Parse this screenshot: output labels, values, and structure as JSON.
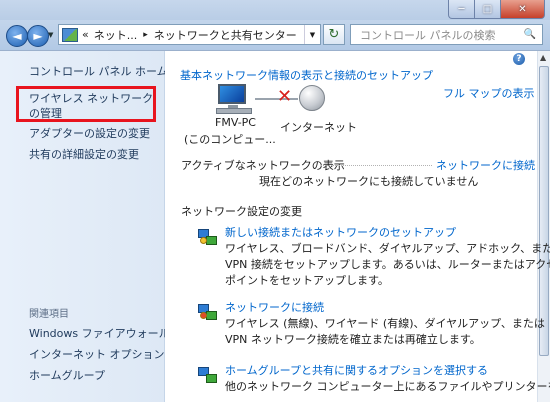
{
  "titlebar": {
    "minimize": "─",
    "maximize": "□",
    "close": "✕"
  },
  "toolbar": {
    "back": "◄",
    "forward": "►",
    "dropdown": "▼",
    "breadcrumb": {
      "overflow": "«",
      "item1": "ネット...",
      "separator": "▸",
      "item2": "ネットワークと共有センター"
    },
    "refresh": "↻",
    "search_placeholder": "コントロール パネルの検索",
    "search_icon": "🔍"
  },
  "sidebar": {
    "home": "コントロール パネル ホーム",
    "wireless": "ワイヤレス ネットワークの管理",
    "adapter": "アダプターの設定の変更",
    "sharing": "共有の詳細設定の変更",
    "related_heading": "関連項目",
    "firewall": "Windows ファイアウォール",
    "internet_options": "インターネット オプション",
    "homegroup": "ホームグループ"
  },
  "main": {
    "help": "?",
    "header_link": "基本ネットワーク情報の表示と接続のセットアップ",
    "full_map": "フル マップの表示",
    "pc_name": "FMV-PC",
    "pc_sub": "(このコンピュー...",
    "internet": "インターネット",
    "active_header": "アクティブなネットワークの表示",
    "connect_link": "ネットワークに接続",
    "not_connected": "現在どのネットワークにも接続していません",
    "settings_header": "ネットワーク設定の変更",
    "tasks": [
      {
        "title": "新しい接続またはネットワークのセットアップ",
        "line1": "ワイヤレス、ブロードバンド、ダイヤルアップ、アドホック、または",
        "line2": "VPN 接続をセットアップします。あるいは、ルーターまたはアクセス",
        "line3": "ポイントをセットアップします。"
      },
      {
        "title": "ネットワークに接続",
        "line1": "ワイヤレス (無線)、ワイヤード (有線)、ダイヤルアップ、または",
        "line2": "VPN ネットワーク接続を確立または再確立します。"
      },
      {
        "title": "ホームグループと共有に関するオプションを選択する",
        "line1": "他のネットワーク コンピューター上にあるファイルやプリンターを利"
      }
    ]
  }
}
